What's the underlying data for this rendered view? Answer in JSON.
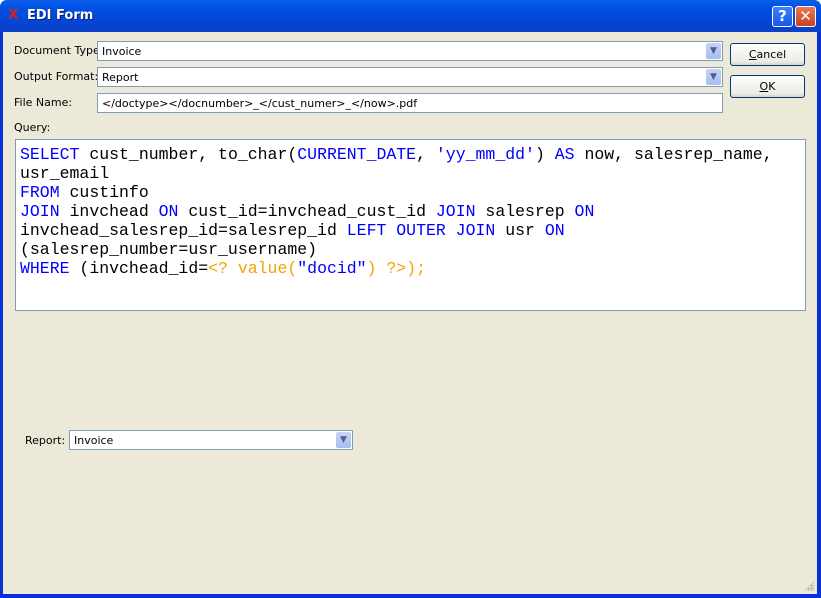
{
  "window": {
    "title": "EDI Form",
    "icon": "xtuple-x-icon",
    "help_label": "?",
    "close_label": "✕"
  },
  "form": {
    "document_type": {
      "label": "Document Type:",
      "value": "Invoice"
    },
    "output_format": {
      "label": "Output Format:",
      "value": "Report"
    },
    "file_name": {
      "label": "File Name:",
      "value": "</doctype></docnumber>_</cust_numer>_</now>.pdf"
    },
    "query_label": "Query:",
    "report": {
      "label": "Report:",
      "value": "Invoice"
    }
  },
  "buttons": {
    "cancel_prefix": "",
    "cancel_mnemonic": "C",
    "cancel_rest": "ancel",
    "ok_mnemonic": "O",
    "ok_rest": "K"
  },
  "colors": {
    "keyword": "#0000ff",
    "string": "#0000ff",
    "param": "#f5a300"
  },
  "query_lines": [
    [
      [
        "k",
        "SELECT"
      ],
      [
        "",
        "  cust_number, to_char("
      ],
      [
        "k",
        "CURRENT_DATE"
      ],
      [
        "",
        ", "
      ],
      [
        "s",
        "'yy_mm_dd'"
      ],
      [
        "",
        ") "
      ],
      [
        "k",
        "AS"
      ],
      [
        "",
        " now, salesrep_name,"
      ]
    ],
    [
      [
        "",
        "usr_email"
      ]
    ],
    [
      [
        "k",
        "FROM"
      ],
      [
        "",
        " custinfo"
      ]
    ],
    [
      [
        "k",
        "JOIN"
      ],
      [
        "",
        " invchead "
      ],
      [
        "k",
        "ON"
      ],
      [
        "",
        " cust_id=invchead_cust_id "
      ],
      [
        "k",
        "JOIN"
      ],
      [
        "",
        " salesrep "
      ],
      [
        "k",
        "ON"
      ]
    ],
    [
      [
        "",
        "invchead_salesrep_id=salesrep_id "
      ],
      [
        "k",
        "LEFT OUTER JOIN"
      ],
      [
        "",
        " usr "
      ],
      [
        "k",
        "ON"
      ]
    ],
    [
      [
        "",
        "(salesrep_number=usr_username)"
      ]
    ],
    [
      [
        "k",
        "WHERE"
      ],
      [
        "",
        " (invchead_id="
      ],
      [
        "p",
        "<? value("
      ],
      [
        "s",
        "\"docid\""
      ],
      [
        "p",
        ") ?>"
      ],
      [
        "p",
        ");"
      ]
    ]
  ]
}
